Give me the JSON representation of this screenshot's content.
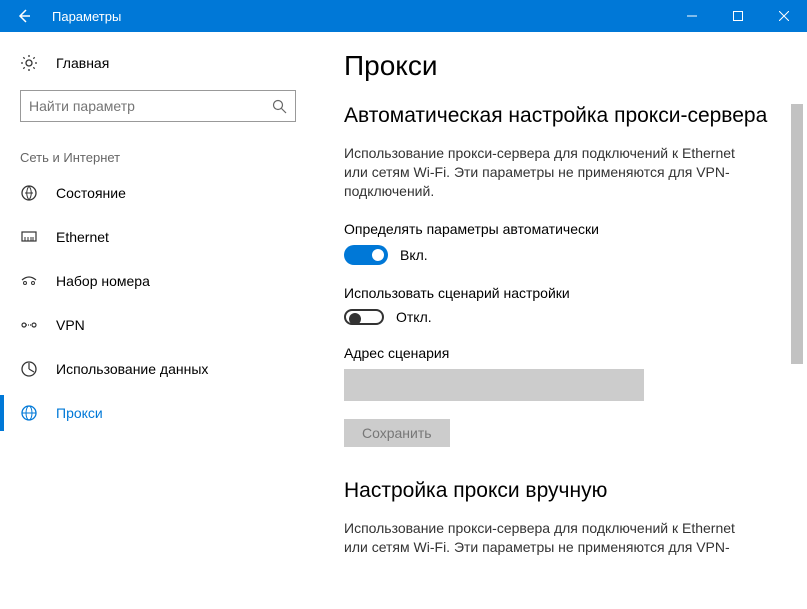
{
  "window": {
    "title": "Параметры"
  },
  "sidebar": {
    "home": "Главная",
    "search_placeholder": "Найти параметр",
    "category": "Сеть и Интернет",
    "items": [
      {
        "label": "Состояние"
      },
      {
        "label": "Ethernet"
      },
      {
        "label": "Набор номера"
      },
      {
        "label": "VPN"
      },
      {
        "label": "Использование данных"
      },
      {
        "label": "Прокси"
      }
    ]
  },
  "main": {
    "title": "Прокси",
    "auto": {
      "heading": "Автоматическая настройка прокси-сервера",
      "description": "Использование прокси-сервера для подключений к Ethernet или сетям Wi-Fi. Эти параметры не применяются для VPN-подключений.",
      "detect_label": "Определять параметры автоматически",
      "detect_state": "Вкл.",
      "script_label": "Использовать сценарий настройки",
      "script_state": "Откл.",
      "script_addr_label": "Адрес сценария",
      "save_btn": "Сохранить"
    },
    "manual": {
      "heading": "Настройка прокси вручную",
      "description": "Использование прокси-сервера для подключений к Ethernet или сетям Wi-Fi. Эти параметры не применяются для VPN-"
    }
  }
}
